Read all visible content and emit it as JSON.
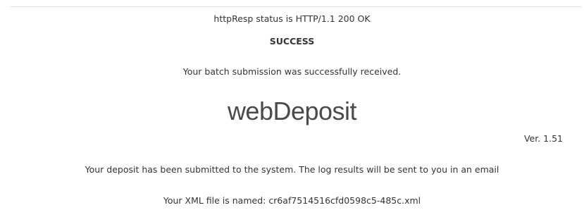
{
  "status_line": "httpResp status is HTTP/1.1 200 OK",
  "heading": "SUCCESS",
  "received_message": "Your batch submission was successfully received.",
  "logo_text": "webDeposit",
  "version": "Ver. 1.51",
  "deposit_message": "Your deposit has been submitted to the system. The log results will be sent to you in an email",
  "xml_file_message": "Your XML file is named: cr6af7514516cfd0598c5-485c.xml"
}
